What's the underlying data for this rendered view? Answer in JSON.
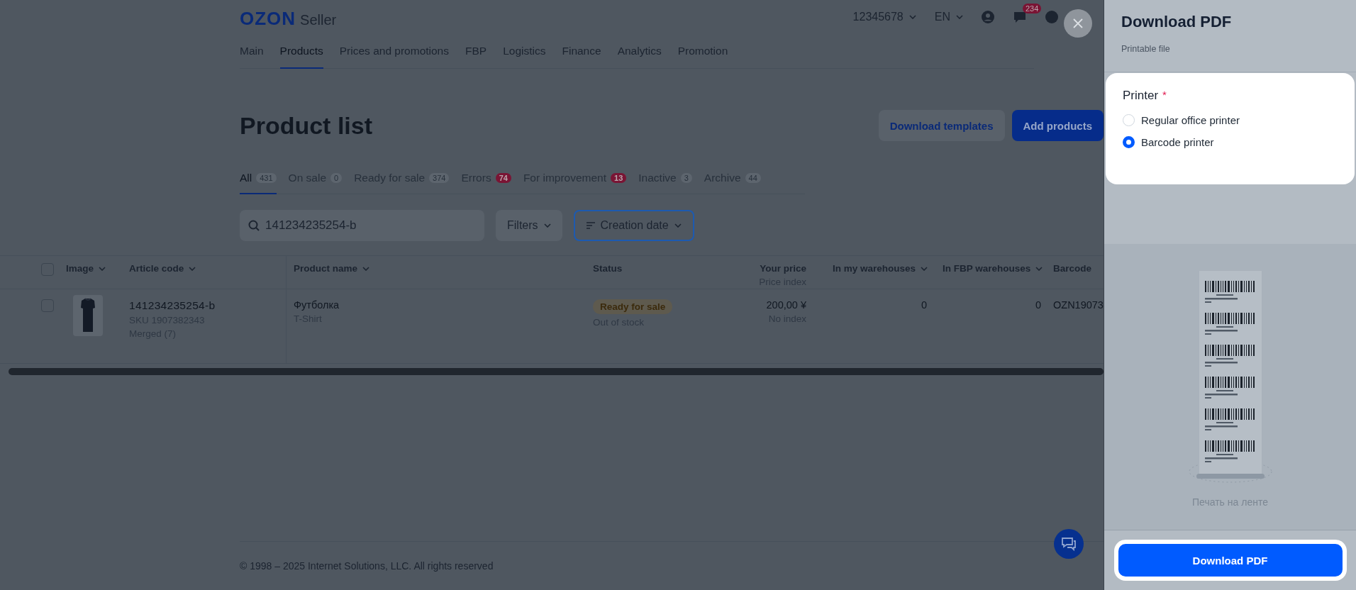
{
  "header": {
    "logo": "OZON",
    "logo_suffix": "Seller",
    "account": "12345678",
    "language": "EN",
    "notifications_badge": "234"
  },
  "nav": [
    {
      "label": "Main",
      "selected": false
    },
    {
      "label": "Products",
      "selected": true
    },
    {
      "label": "Prices and promotions",
      "selected": false
    },
    {
      "label": "FBP",
      "selected": false
    },
    {
      "label": "Logistics",
      "selected": false
    },
    {
      "label": "Finance",
      "selected": false
    },
    {
      "label": "Analytics",
      "selected": false
    },
    {
      "label": "Promotion",
      "selected": false
    }
  ],
  "page": {
    "title": "Product list",
    "buttons": [
      {
        "label": "Download templates",
        "kind": "secondary"
      },
      {
        "label": "Add products",
        "kind": "primary"
      }
    ]
  },
  "tabs": [
    {
      "label": "All",
      "count": "431",
      "kind": "neutral",
      "selected": true
    },
    {
      "label": "On sale",
      "count": "0",
      "kind": "neutral",
      "selected": false
    },
    {
      "label": "Ready for sale",
      "count": "374",
      "kind": "neutral",
      "selected": false
    },
    {
      "label": "Errors",
      "count": "74",
      "kind": "alert",
      "selected": false
    },
    {
      "label": "For improvement",
      "count": "13",
      "kind": "alert",
      "selected": false
    },
    {
      "label": "Inactive",
      "count": "3",
      "kind": "neutral",
      "selected": false
    },
    {
      "label": "Archive",
      "count": "44",
      "kind": "neutral",
      "selected": false
    }
  ],
  "search": {
    "value": "141234235254-b"
  },
  "filters": {
    "label": "Filters"
  },
  "sort": {
    "label": "Creation date"
  },
  "table": {
    "columns": [
      {
        "label": "Image",
        "sortable": true
      },
      {
        "label": "Article code",
        "sortable": true
      },
      {
        "label": "Product name",
        "sortable": true
      },
      {
        "label": "Status",
        "sortable": false
      },
      {
        "label": "Your price",
        "sublabel": "Price index",
        "sortable": false
      },
      {
        "label": "In my warehouses",
        "sortable": true
      },
      {
        "label": "In FBP warehouses",
        "sortable": true
      },
      {
        "label": "Barcode",
        "sortable": false
      }
    ],
    "select_all_checked": false,
    "rows": [
      {
        "checked": false,
        "article": "141234235254-b",
        "sku": "SKU 1907382343",
        "merged": "Merged (7)",
        "name": "Футболка",
        "name_sub": "T-Shirt",
        "status": "Ready for sale",
        "stock": "Out of stock",
        "price": "200,00 ¥",
        "price_index": "No index",
        "my_warehouses": "0",
        "fbp_warehouses": "0",
        "barcode": "OZN19073"
      }
    ]
  },
  "footer": {
    "copyright": "© 1998 – 2025 Internet Solutions, LLC. All rights reserved"
  },
  "panel": {
    "title": "Download PDF",
    "subtitle": "Printable file",
    "field_label": "Printer",
    "required_mark": "*",
    "options": [
      {
        "label": "Regular office printer",
        "selected": false
      },
      {
        "label": "Barcode printer",
        "selected": true
      }
    ],
    "preview_caption": "Печать на ленте",
    "button": "Download PDF"
  }
}
